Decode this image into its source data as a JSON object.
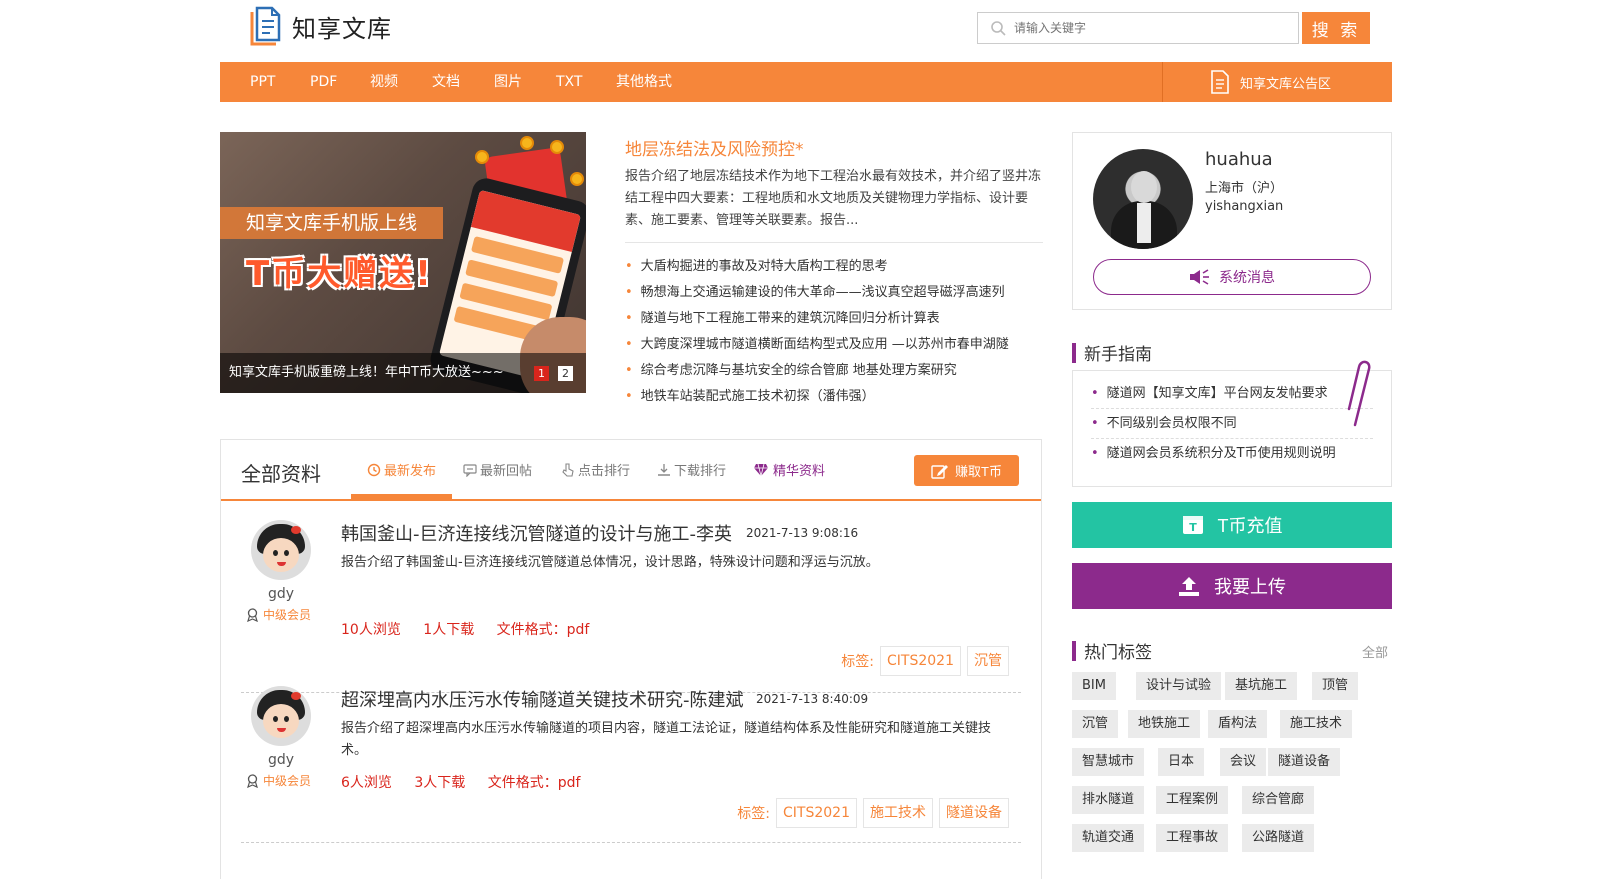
{
  "header": {
    "logo_text": "知享文库",
    "search_placeholder": "请输入关键字",
    "search_button": "搜 索"
  },
  "nav": {
    "items": [
      "PPT",
      "PDF",
      "视频",
      "文档",
      "图片",
      "TXT",
      "其他格式"
    ],
    "notice": "知享文库公告区"
  },
  "banner": {
    "tag_text": "知享文库手机版上线",
    "big_text": "T币大赠送!",
    "caption": "知享文库手机版重磅上线！年中T币大放送~~~",
    "pages": [
      "1",
      "2"
    ],
    "active_page": "1"
  },
  "featured": {
    "title": "地层冻结法及风险预控*",
    "description": "报告介绍了地层冻结技术作为地下工程治水最有效技术，并介绍了竖井冻结工程中四大要素：工程地质和水文地质及关键物理力学指标、设计要素、施工要素、管理等关联要素。报告...",
    "list": [
      "大盾构掘进的事故及对特大盾构工程的思考",
      "畅想海上交通运输建设的伟大革命——浅议真空超导磁浮高速列",
      "隧道与地下工程施工带来的建筑沉降回归分析计算表",
      "大跨度深埋城市隧道横断面结构型式及应用 —以苏州市春申湖隧",
      "综合考虑沉降与基坑安全的综合管廊 地基处理方案研究",
      "地铁车站装配式施工技术初探（潘伟强）"
    ]
  },
  "profile": {
    "username": "huahua",
    "city": "上海市（沪）",
    "nickname": "yishangxian",
    "message_button": "系统消息"
  },
  "guide": {
    "title": "新手指南",
    "items": [
      "隧道网【知享文库】平台网友发帖要求",
      "不同级别会员权限不同",
      "隧道网会员系统积分及T币使用规则说明"
    ]
  },
  "actions": {
    "recharge": "T币充值",
    "upload": "我要上传"
  },
  "hot_tags": {
    "title": "热门标签",
    "all_link": "全部",
    "tags": [
      "BIM",
      "设计与试验",
      "基坑施工",
      "顶管",
      "沉管",
      "地铁施工",
      "盾构法",
      "施工技术",
      "智慧城市",
      "日本",
      "会议",
      "隧道设备",
      "排水隧道",
      "工程案例",
      "综合管廊",
      "轨道交通",
      "工程事故",
      "公路隧道"
    ]
  },
  "main": {
    "title": "全部资料",
    "tabs": [
      "最新发布",
      "最新回帖",
      "点击排行",
      "下载排行",
      "精华资料"
    ],
    "active_tab": "最新发布",
    "earn_button": "赚取T币",
    "tag_label": "标签:",
    "items": [
      {
        "user": "gdy",
        "level": "中级会员",
        "title": "韩国釜山-巨济连接线沉管隧道的设计与施工-李英",
        "date": "2021-7-13 9:08:16",
        "desc": "报告介绍了韩国釜山-巨济连接线沉管隧道总体情况，设计思路，特殊设计问题和浮运与沉放。",
        "views": "10人浏览",
        "downloads": "1人下载",
        "format": "文件格式：pdf",
        "tags": [
          "CITS2021",
          "沉管"
        ]
      },
      {
        "user": "gdy",
        "level": "中级会员",
        "title": "超深埋高内水压污水传输隧道关键技术研究-陈建斌",
        "date": "2021-7-13 8:40:09",
        "desc": "报告介绍了超深埋高内水压污水传输隧道的项目内容，隧道工法论证，隧道结构体系及性能研究和隧道施工关键技术。",
        "views": "6人浏览",
        "downloads": "3人下载",
        "format": "文件格式：pdf",
        "tags": [
          "CITS2021",
          "施工技术",
          "隧道设备"
        ]
      }
    ]
  },
  "colors": {
    "accent": "#f6863a",
    "purple": "#8c2a8c",
    "teal": "#23c4a3",
    "red": "#d9251c"
  }
}
